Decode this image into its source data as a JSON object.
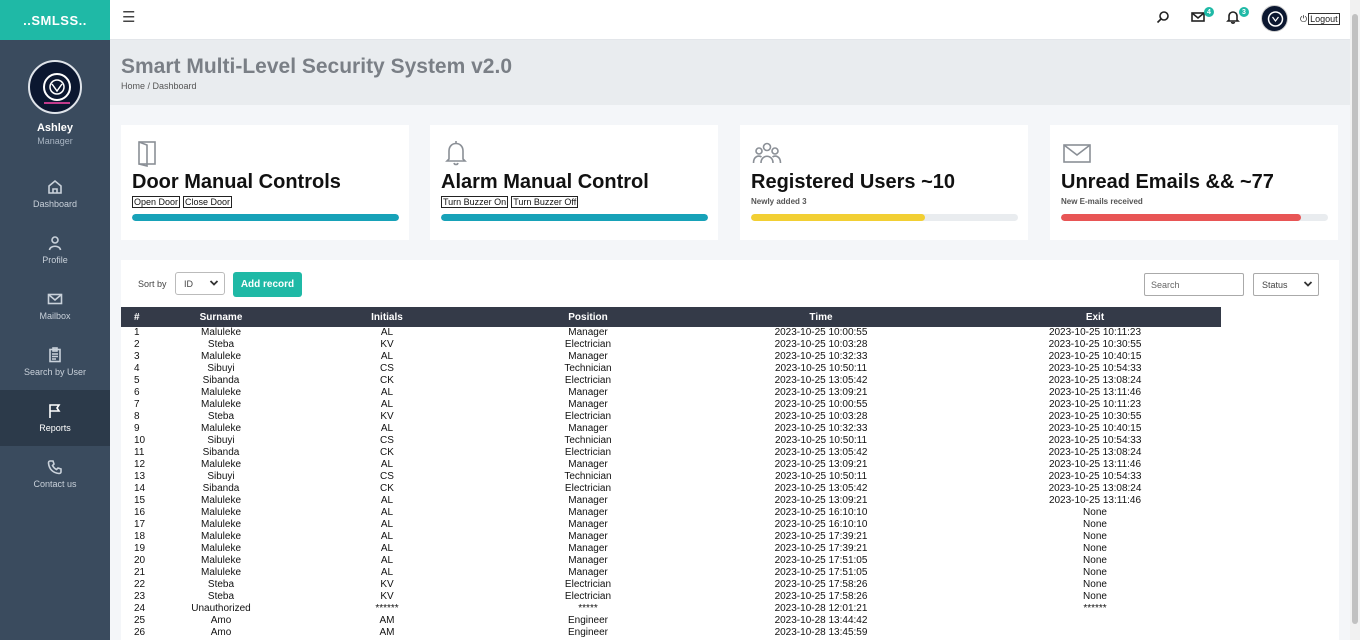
{
  "app": {
    "brand": "..SMLSS.."
  },
  "sidebar": {
    "user": {
      "name": "Ashley",
      "role": "Manager"
    },
    "items": [
      {
        "label": "Dashboard",
        "icon": "home-icon"
      },
      {
        "label": "Profile",
        "icon": "user-icon"
      },
      {
        "label": "Mailbox",
        "icon": "mail-icon"
      },
      {
        "label": "Search by User",
        "icon": "clipboard-icon"
      },
      {
        "label": "Reports",
        "icon": "flag-icon",
        "active": true
      },
      {
        "label": "Contact us",
        "icon": "phone-icon"
      }
    ]
  },
  "topbar": {
    "messages_count": "4",
    "notifications_count": "3",
    "logout_label": "Logout"
  },
  "header": {
    "title": "Smart Multi-Level Security System v2.0",
    "breadcrumb": "Home / Dashboard"
  },
  "cards": [
    {
      "title": "Door Manual Controls",
      "buttons": [
        "Open Door",
        "Close Door"
      ],
      "bar_color": "#17a2b8",
      "progress": 1.0,
      "icon": "door-icon"
    },
    {
      "title": "Alarm Manual Control",
      "buttons": [
        "Turn Buzzer On",
        "Turn Buzzer Off"
      ],
      "bar_color": "#17a2b8",
      "progress": 1.0,
      "icon": "bell-icon"
    },
    {
      "title": "Registered Users ~10",
      "subtitle": "Newly added 3",
      "bar_color": "#f2cf33",
      "progress": 0.65,
      "icon": "users-icon"
    },
    {
      "title": "Unread Emails && ~77",
      "subtitle": "New E-mails received",
      "bar_color": "#e85555",
      "progress": 0.9,
      "icon": "envelope-icon"
    }
  ],
  "records": {
    "sort_label": "Sort by",
    "sort_value": "ID",
    "add_label": "Add record",
    "search_placeholder": "Search",
    "status_value": "Status",
    "columns": [
      "#",
      "Surname",
      "Initials",
      "Position",
      "Time",
      "Exit"
    ],
    "rows": [
      [
        "1",
        "Maluleke",
        "AL",
        "Manager",
        "2023-10-25 10:00:55",
        "2023-10-25 10:11:23"
      ],
      [
        "2",
        "Steba",
        "KV",
        "Electrician",
        "2023-10-25 10:03:28",
        "2023-10-25 10:30:55"
      ],
      [
        "3",
        "Maluleke",
        "AL",
        "Manager",
        "2023-10-25 10:32:33",
        "2023-10-25 10:40:15"
      ],
      [
        "4",
        "Sibuyi",
        "CS",
        "Technician",
        "2023-10-25 10:50:11",
        "2023-10-25 10:54:33"
      ],
      [
        "5",
        "Sibanda",
        "CK",
        "Electrician",
        "2023-10-25 13:05:42",
        "2023-10-25 13:08:24"
      ],
      [
        "6",
        "Maluleke",
        "AL",
        "Manager",
        "2023-10-25 13:09:21",
        "2023-10-25 13:11:46"
      ],
      [
        "7",
        "Maluleke",
        "AL",
        "Manager",
        "2023-10-25 10:00:55",
        "2023-10-25 10:11:23"
      ],
      [
        "8",
        "Steba",
        "KV",
        "Electrician",
        "2023-10-25 10:03:28",
        "2023-10-25 10:30:55"
      ],
      [
        "9",
        "Maluleke",
        "AL",
        "Manager",
        "2023-10-25 10:32:33",
        "2023-10-25 10:40:15"
      ],
      [
        "10",
        "Sibuyi",
        "CS",
        "Technician",
        "2023-10-25 10:50:11",
        "2023-10-25 10:54:33"
      ],
      [
        "11",
        "Sibanda",
        "CK",
        "Electrician",
        "2023-10-25 13:05:42",
        "2023-10-25 13:08:24"
      ],
      [
        "12",
        "Maluleke",
        "AL",
        "Manager",
        "2023-10-25 13:09:21",
        "2023-10-25 13:11:46"
      ],
      [
        "13",
        "Sibuyi",
        "CS",
        "Technician",
        "2023-10-25 10:50:11",
        "2023-10-25 10:54:33"
      ],
      [
        "14",
        "Sibanda",
        "CK",
        "Electrician",
        "2023-10-25 13:05:42",
        "2023-10-25 13:08:24"
      ],
      [
        "15",
        "Maluleke",
        "AL",
        "Manager",
        "2023-10-25 13:09:21",
        "2023-10-25 13:11:46"
      ],
      [
        "16",
        "Maluleke",
        "AL",
        "Manager",
        "2023-10-25 16:10:10",
        "None"
      ],
      [
        "17",
        "Maluleke",
        "AL",
        "Manager",
        "2023-10-25 16:10:10",
        "None"
      ],
      [
        "18",
        "Maluleke",
        "AL",
        "Manager",
        "2023-10-25 17:39:21",
        "None"
      ],
      [
        "19",
        "Maluleke",
        "AL",
        "Manager",
        "2023-10-25 17:39:21",
        "None"
      ],
      [
        "20",
        "Maluleke",
        "AL",
        "Manager",
        "2023-10-25 17:51:05",
        "None"
      ],
      [
        "21",
        "Maluleke",
        "AL",
        "Manager",
        "2023-10-25 17:51:05",
        "None"
      ],
      [
        "22",
        "Steba",
        "KV",
        "Electrician",
        "2023-10-25 17:58:26",
        "None"
      ],
      [
        "23",
        "Steba",
        "KV",
        "Electrician",
        "2023-10-25 17:58:26",
        "None"
      ],
      [
        "24",
        "Unauthorized",
        "******",
        "*****",
        "2023-10-28 12:01:21",
        "******"
      ],
      [
        "25",
        "Amo",
        "AM",
        "Engineer",
        "2023-10-28 13:44:42",
        ""
      ],
      [
        "26",
        "Amo",
        "AM",
        "Engineer",
        "2023-10-28 13:45:59",
        ""
      ]
    ]
  }
}
